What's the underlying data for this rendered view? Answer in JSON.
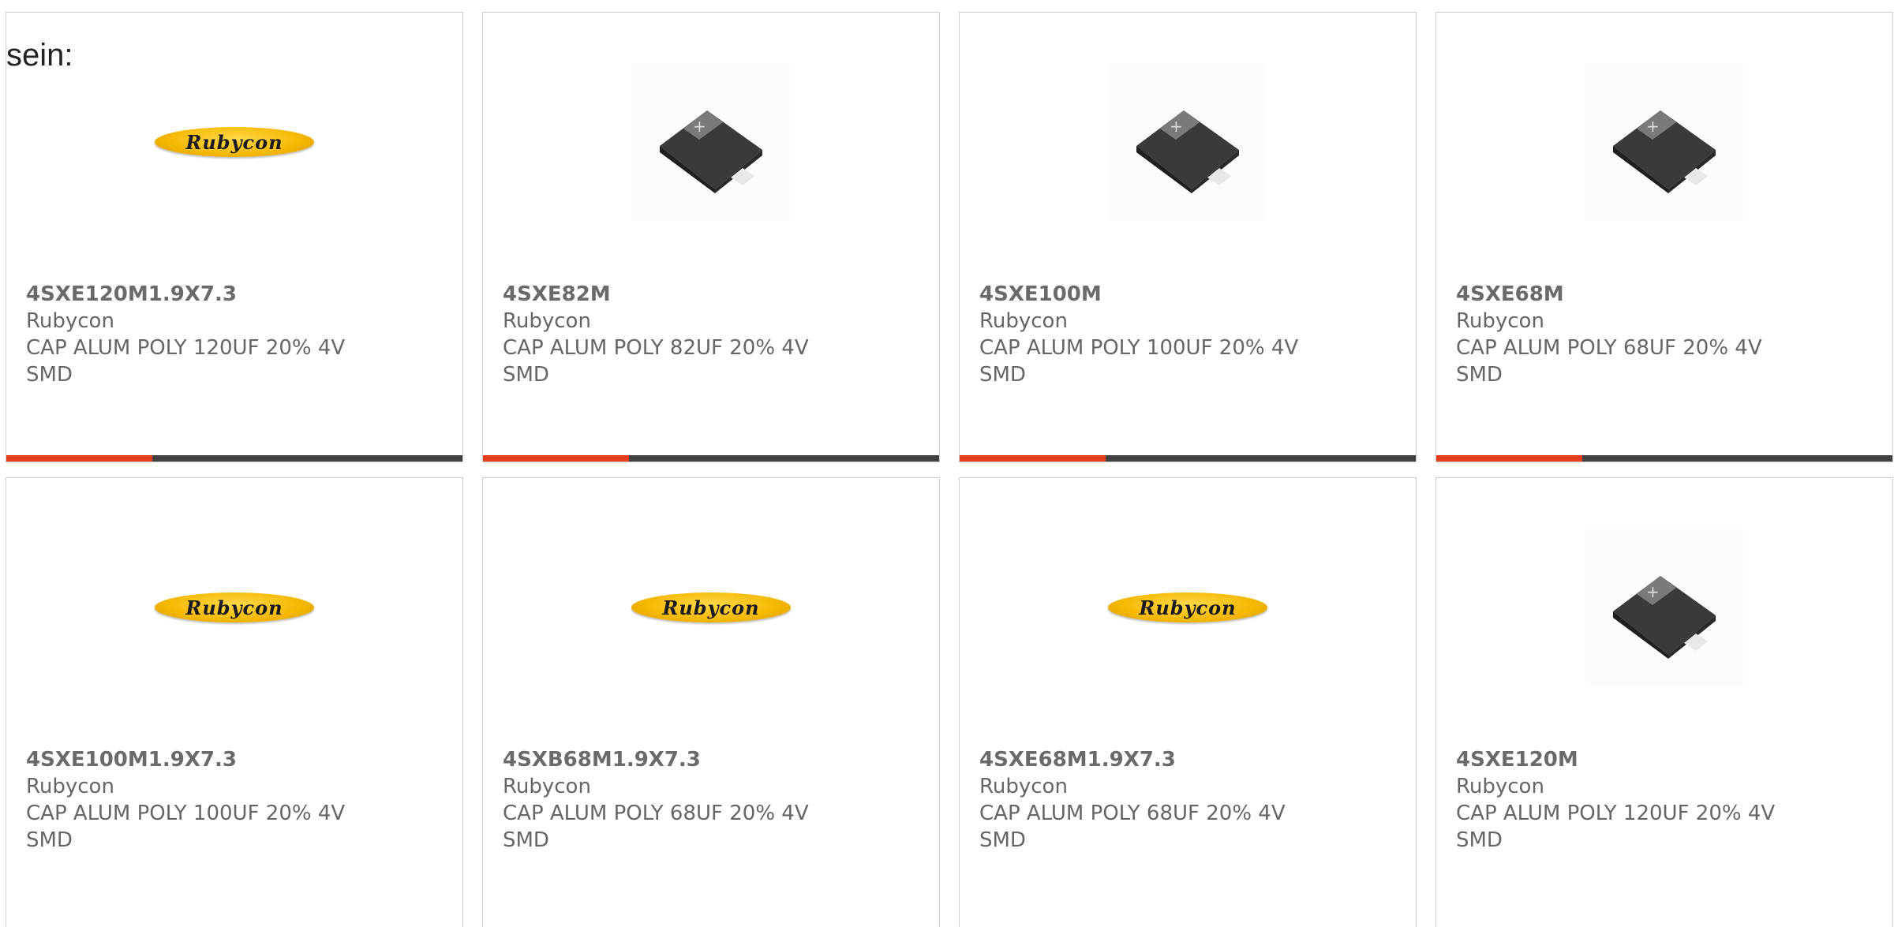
{
  "section_title": "sein:",
  "products": [
    {
      "part_number": "4SXE120M1.9X7.3",
      "manufacturer": "Rubycon",
      "description": "CAP ALUM POLY 120UF 20% 4V SMD",
      "image": "rubycon-logo",
      "logo_text": "Rubycon",
      "progress": 0.32
    },
    {
      "part_number": "4SXE82M",
      "manufacturer": "Rubycon",
      "description": "CAP ALUM POLY 82UF 20% 4V SMD",
      "image": "smd-capacitor",
      "progress": 0.32
    },
    {
      "part_number": "4SXE100M",
      "manufacturer": "Rubycon",
      "description": "CAP ALUM POLY 100UF 20% 4V SMD",
      "image": "smd-capacitor",
      "progress": 0.32
    },
    {
      "part_number": "4SXE68M",
      "manufacturer": "Rubycon",
      "description": "CAP ALUM POLY 68UF 20% 4V SMD",
      "image": "smd-capacitor",
      "progress": 0.32
    },
    {
      "part_number": "4SXE100M1.9X7.3",
      "manufacturer": "Rubycon",
      "description": "CAP ALUM POLY 100UF 20% 4V SMD",
      "image": "rubycon-logo",
      "logo_text": "Rubycon"
    },
    {
      "part_number": "4SXB68M1.9X7.3",
      "manufacturer": "Rubycon",
      "description": "CAP ALUM POLY 68UF 20% 4V SMD",
      "image": "rubycon-logo",
      "logo_text": "Rubycon"
    },
    {
      "part_number": "4SXE68M1.9X7.3",
      "manufacturer": "Rubycon",
      "description": "CAP ALUM POLY 68UF 20% 4V SMD",
      "image": "rubycon-logo",
      "logo_text": "Rubycon"
    },
    {
      "part_number": "4SXE120M",
      "manufacturer": "Rubycon",
      "description": "CAP ALUM POLY 120UF 20% 4V SMD",
      "image": "smd-capacitor"
    }
  ],
  "colors": {
    "accent": "#e5401e",
    "bar_track": "#414141",
    "text": "#666666",
    "border": "#cccccc",
    "logo": "#f5b800"
  }
}
